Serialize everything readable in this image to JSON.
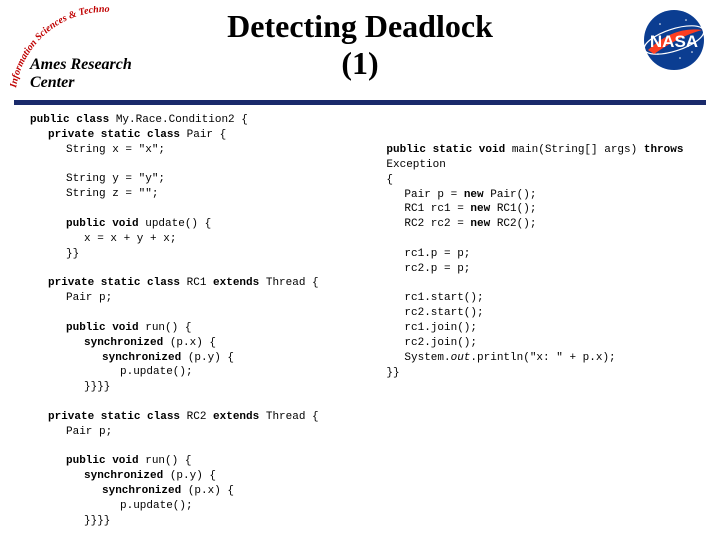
{
  "header": {
    "title_line1": "Detecting Deadlock",
    "title_line2": "(1)",
    "arc_text_top": "Information Sciences & Technology",
    "ames_text": "Ames Research Center"
  },
  "code": {
    "left": {
      "l1a": "public class ",
      "l1b": "My.Race.Condition2 {",
      "l2a": "private static class ",
      "l2b": "Pair {",
      "l3": "String x = \"x\";",
      "l4": "String y = \"y\";",
      "l5": "String z = \"\";",
      "l6a": "public void ",
      "l6b": "update() {",
      "l7": "x = x + y + x;",
      "l8": "}}",
      "l9a": "private static class ",
      "l9b": "RC1 ",
      "l9c": "extends ",
      "l9d": "Thread {",
      "l10": "Pair p;",
      "l11a": "public void ",
      "l11b": "run() {",
      "l12a": "synchronized ",
      "l12b": "(p.x) {",
      "l13a": "synchronized ",
      "l13b": "(p.y) {",
      "l14": "p.update();",
      "l15": "}}}}",
      "l16a": "private static class ",
      "l16b": "RC2 ",
      "l16c": "extends ",
      "l16d": "Thread {",
      "l17": "Pair p;",
      "l18a": "public void ",
      "l18b": "run() {",
      "l19a": "synchronized ",
      "l19b": "(p.y) {",
      "l20a": "synchronized ",
      "l20b": "(p.x) {",
      "l21": "p.update();",
      "l22": "}}}}"
    },
    "right": {
      "r1a": "public static void ",
      "r1b": "main(String[] args) ",
      "r1c": "throws",
      "r2": "Exception",
      "r3": "{",
      "r4a": "Pair p = ",
      "r4b": "new ",
      "r4c": "Pair();",
      "r5a": "RC1 rc1 = ",
      "r5b": "new ",
      "r5c": "RC1();",
      "r6a": "RC2 rc2 = ",
      "r6b": "new ",
      "r6c": "RC2();",
      "r7": "rc1.p = p;",
      "r8": "rc2.p = p;",
      "r9": "rc1.start();",
      "r10": "rc2.start();",
      "r11": "rc1.join();",
      "r12": "rc2.join();",
      "r13a": "System.",
      "r13b": "out",
      "r13c": ".println(\"x: \" + p.x);",
      "r14": "}}"
    }
  }
}
